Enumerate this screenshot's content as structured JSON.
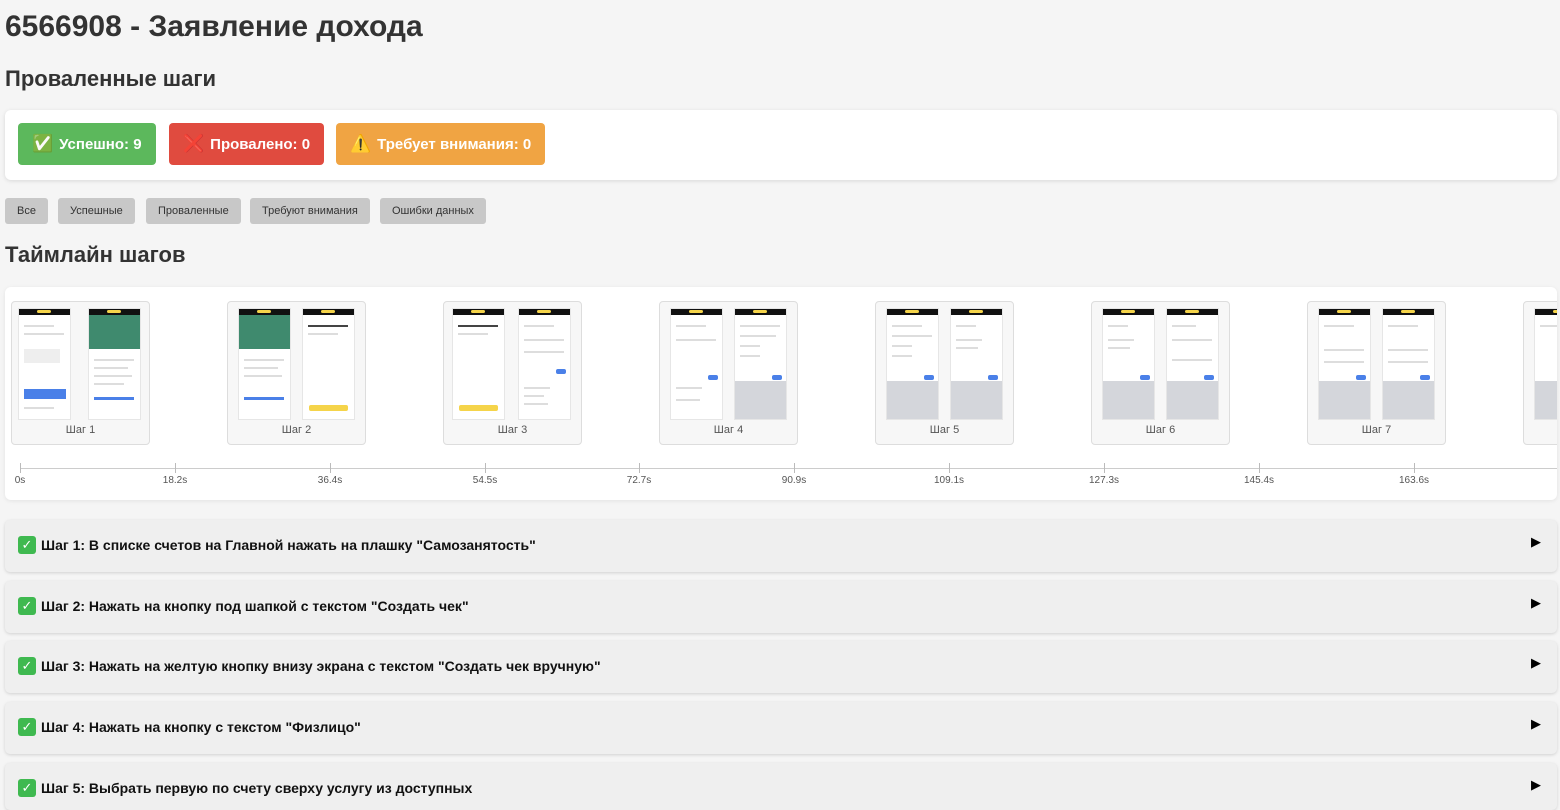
{
  "page_title": "6566908 - Заявление дохода",
  "sections": {
    "failed_steps": "Проваленные шаги",
    "timeline": "Таймлайн шагов"
  },
  "summary": {
    "success": {
      "icon": "✅",
      "label": "Успешно: 9",
      "color": "#5cb85c"
    },
    "failed": {
      "icon": "❌",
      "label": "Провалено: 0",
      "color": "#e04b3f"
    },
    "attention": {
      "icon": "⚠️",
      "label": "Требует внимания: 0",
      "color": "#f0a443"
    }
  },
  "filters": [
    "Все",
    "Успешные",
    "Проваленные",
    "Требуют внимания",
    "Ошибки данных"
  ],
  "timeline": {
    "cards": [
      {
        "label": "Шаг 1"
      },
      {
        "label": "Шаг 2"
      },
      {
        "label": "Шаг 3"
      },
      {
        "label": "Шаг 4"
      },
      {
        "label": "Шаг 5"
      },
      {
        "label": "Шаг 6"
      },
      {
        "label": "Шаг 7"
      }
    ],
    "ticks": [
      "0s",
      "18.2s",
      "36.4s",
      "54.5s",
      "72.7s",
      "90.9s",
      "109.1s",
      "127.3s",
      "145.4s",
      "163.6s"
    ]
  },
  "steps": [
    {
      "title": "Шаг 1: В списке счетов на Главной нажать на плашку \"Самозанятость\"",
      "status_icon": "check-icon"
    },
    {
      "title": "Шаг 2: Нажать на кнопку под шапкой с текстом \"Создать чек\"",
      "status_icon": "check-icon"
    },
    {
      "title": "Шаг 3: Нажать на желтую кнопку внизу экрана с текстом \"Создать чек вручную\"",
      "status_icon": "check-icon"
    },
    {
      "title": "Шаг 4: Нажать на кнопку с текстом \"Физлицо\"",
      "status_icon": "check-icon"
    },
    {
      "title": "Шаг 5: Выбрать первую по счету сверху услугу из доступных",
      "status_icon": "check-icon"
    }
  ]
}
